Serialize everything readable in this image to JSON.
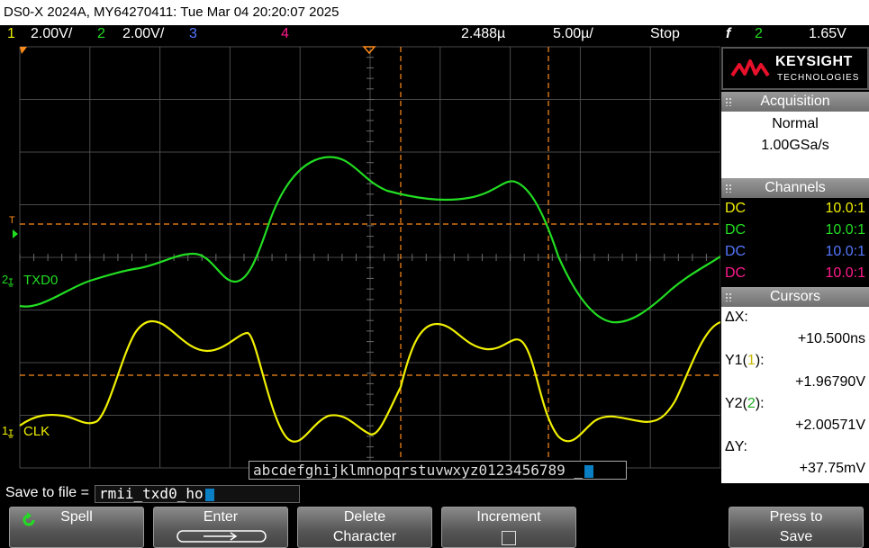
{
  "title": "DS0-X 2024A, MY64270411: Tue Mar 04 20:20:07 2025",
  "status": {
    "ch1_num": "1",
    "ch1_scale": "2.00V/",
    "ch2_num": "2",
    "ch2_scale": "2.00V/",
    "ch3_num": "3",
    "ch4_num": "4",
    "time_delay": "2.488µ",
    "time_scale": "5.00µ/",
    "run_state": "Stop",
    "trigger_symbol": "f",
    "trigger_source": "2",
    "trigger_level": "1.65V"
  },
  "waveforms": {
    "txd0_label": "TXD0",
    "txd0_marker": "2",
    "clk_label": "CLK",
    "clk_marker": "1",
    "trigger_marker": "T"
  },
  "panel": {
    "brand": "KEYSIGHT",
    "tech": "TECHNOLOGIES",
    "acq_header": "Acquisition",
    "acq_mode": "Normal",
    "acq_rate": "1.00GSa/s",
    "ch_header": "Channels",
    "channels": [
      {
        "coupling": "DC",
        "probe": "10.0:1",
        "color": "#f0f000"
      },
      {
        "coupling": "DC",
        "probe": "10.0:1",
        "color": "#22dd22"
      },
      {
        "coupling": "DC",
        "probe": "10.0:1",
        "color": "#5577ff"
      },
      {
        "coupling": "DC",
        "probe": "10.0:1",
        "color": "#ff1a8c"
      }
    ],
    "cursor_header": "Cursors",
    "dx_label": "ΔX:",
    "dx_value": "+10.500ns",
    "y1_label_a": "Y1(",
    "y1_label_n": "1",
    "y1_label_b": "):",
    "y1_value": "+1.96790V",
    "y2_label_a": "Y2(",
    "y2_label_n": "2",
    "y2_label_b": "):",
    "y2_value": "+2.00571V",
    "dy_label": "ΔY:",
    "dy_value": "+37.75mV"
  },
  "keyboard": {
    "chars": "abcdefghijklmnopqrstuvwxyz0123456789 _"
  },
  "save": {
    "label": "Save to file =",
    "value": "rmii_txd0_ho"
  },
  "softkeys": {
    "spell": "Spell",
    "enter": "Enter",
    "delete_1": "Delete",
    "delete_2": "Character",
    "increment": "Increment",
    "press_1": "Press to",
    "press_2": "Save"
  },
  "colors": {
    "ch1": "#f0f000",
    "ch2": "#22dd22",
    "ch3": "#5577ff",
    "ch4": "#ff1a8c",
    "cursor": "#ff8c1a"
  }
}
